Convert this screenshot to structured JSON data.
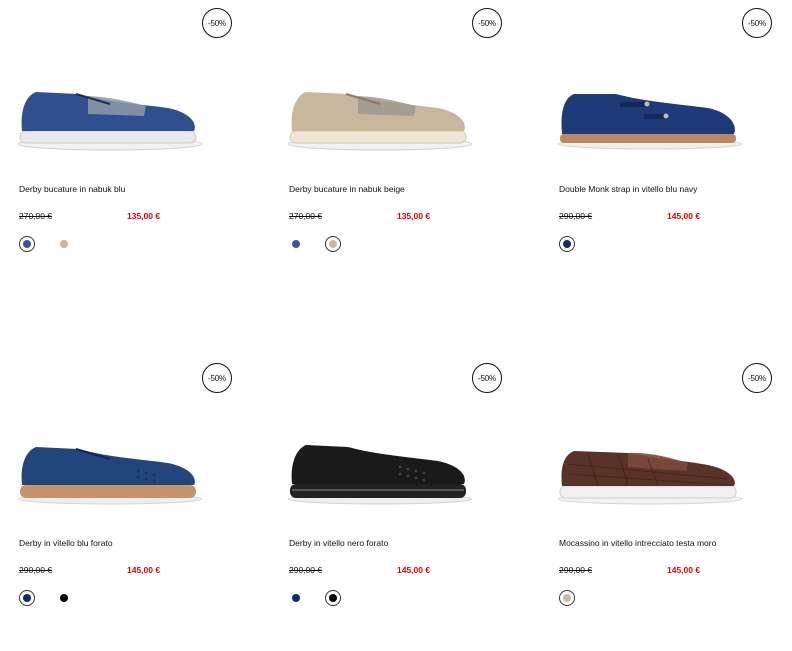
{
  "products": [
    {
      "badge": "-50%",
      "title": "Derby bucature in nabuk blu",
      "old_price": "270,00 €",
      "new_price": "135,00 €",
      "swatches": [
        {
          "color": "#3a52a8",
          "selected": true
        },
        {
          "color": "#c9b79c",
          "selected": false
        }
      ],
      "upper_color": "#2f4f8f",
      "sole_color": "#f2f2f2"
    },
    {
      "badge": "-50%",
      "title": "Derby bucature in nabuk beige",
      "old_price": "270,00 €",
      "new_price": "135,00 €",
      "swatches": [
        {
          "color": "#3a52a8",
          "selected": false
        },
        {
          "color": "#c9b79c",
          "selected": true
        }
      ],
      "upper_color": "#c8b79d",
      "sole_color": "#f2f2f2"
    },
    {
      "badge": "-50%",
      "title": "Double Monk strap in vitello blu navy",
      "old_price": "290,00 €",
      "new_price": "145,00 €",
      "swatches": [
        {
          "color": "#102a66",
          "selected": true
        }
      ],
      "upper_color": "#1e3a78",
      "sole_color": "#b98a62"
    },
    {
      "badge": "-50%",
      "title": "Derby in vitello blu forato",
      "old_price": "290,00 €",
      "new_price": "145,00 €",
      "swatches": [
        {
          "color": "#102a66",
          "selected": true
        },
        {
          "color": "#000000",
          "selected": false
        }
      ],
      "upper_color": "#23457e",
      "sole_color": "#c49369"
    },
    {
      "badge": "-50%",
      "title": "Derby in vitello nero forato",
      "old_price": "290,00 €",
      "new_price": "145,00 €",
      "swatches": [
        {
          "color": "#102a66",
          "selected": false
        },
        {
          "color": "#000000",
          "selected": true
        }
      ],
      "upper_color": "#1a1a1a",
      "sole_color": "#222222"
    },
    {
      "badge": "-50%",
      "title": "Mocassino in vitello intrecciato testa moro",
      "old_price": "290,00 €",
      "new_price": "145,00 €",
      "swatches": [
        {
          "color": "#c8b9ad",
          "selected": true
        }
      ],
      "upper_color": "#5a3328",
      "sole_color": "#f0f0f0"
    }
  ]
}
